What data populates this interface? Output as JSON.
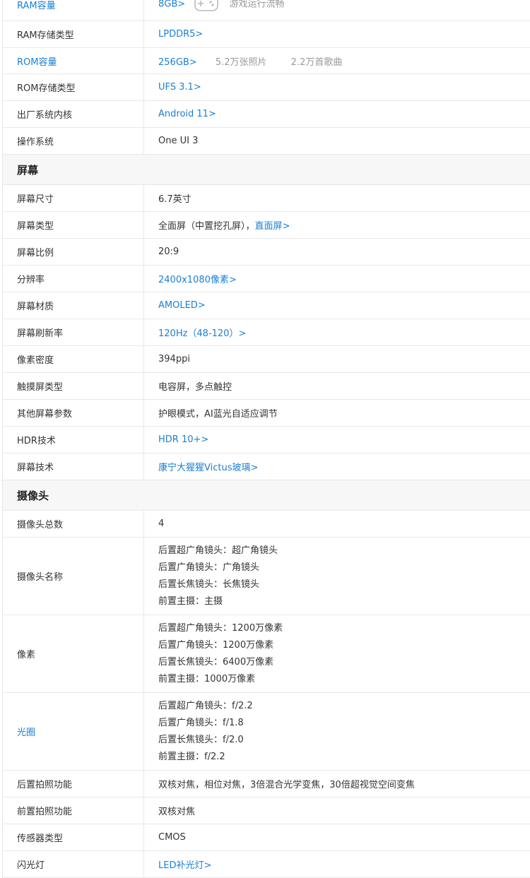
{
  "storage": {
    "ram": {
      "label": "RAM容量",
      "value": "8GB>",
      "extra": "游戏运行流畅",
      "icon": "gamepad-icon"
    },
    "ram_type": {
      "label": "RAM存储类型",
      "value": "LPDDR5>"
    },
    "rom": {
      "label": "ROM容量",
      "value": "256GB>",
      "extra1": "5.2万张照片",
      "extra2": "2.2万首歌曲"
    },
    "rom_type": {
      "label": "ROM存储类型",
      "value": "UFS 3.1>"
    },
    "kernel": {
      "label": "出厂系统内核",
      "value": "Android 11>"
    },
    "os": {
      "label": "操作系统",
      "value": "One UI 3"
    }
  },
  "screen": {
    "title": "屏幕",
    "size": {
      "label": "屏幕尺寸",
      "value": "6.7英寸"
    },
    "type": {
      "label": "屏幕类型",
      "value": "全面屏（中置挖孔屏），",
      "link": "直面屏>"
    },
    "ratio": {
      "label": "屏幕比例",
      "value": "20:9"
    },
    "resolution": {
      "label": "分辨率",
      "value": "2400x1080像素>"
    },
    "material": {
      "label": "屏幕材质",
      "value": "AMOLED>"
    },
    "refresh": {
      "label": "屏幕刷新率",
      "value": "120Hz（48-120）>"
    },
    "density": {
      "label": "像素密度",
      "value": "394ppi"
    },
    "touch": {
      "label": "触摸屏类型",
      "value": "电容屏，多点触控"
    },
    "other": {
      "label": "其他屏幕参数",
      "value": "护眼模式，AI蓝光自适应调节"
    },
    "hdr": {
      "label": "HDR技术",
      "value": "HDR 10+>"
    },
    "tech": {
      "label": "屏幕技术",
      "value": "康宁大猩猩Victus玻璃>"
    }
  },
  "camera": {
    "title": "摄像头",
    "count": {
      "label": "摄像头总数",
      "value": "4"
    },
    "names": {
      "label": "摄像头名称",
      "lines": [
        "后置超广角镜头：超广角镜头",
        "后置广角镜头：广角镜头",
        "后置长焦镜头：长焦镜头",
        "前置主摄：主摄"
      ]
    },
    "pixels": {
      "label": "像素",
      "lines": [
        "后置超广角镜头：1200万像素",
        "后置广角镜头：1200万像素",
        "后置长焦镜头：6400万像素",
        "前置主摄：1000万像素"
      ]
    },
    "aperture": {
      "label": "光圈",
      "lines": [
        "后置超广角镜头：f/2.2",
        "后置广角镜头：f/1.8",
        "后置长焦镜头：f/2.0",
        "前置主摄：f/2.2"
      ]
    },
    "rear_func": {
      "label": "后置拍照功能",
      "value": "双核对焦，相位对焦，3倍混合光学变焦，30倍超视觉空间变焦"
    },
    "front_func": {
      "label": "前置拍照功能",
      "value": "双核对焦"
    },
    "sensor": {
      "label": "传感器类型",
      "value": "CMOS"
    },
    "flash": {
      "label": "闪光灯",
      "value": "LED补光灯>"
    }
  }
}
